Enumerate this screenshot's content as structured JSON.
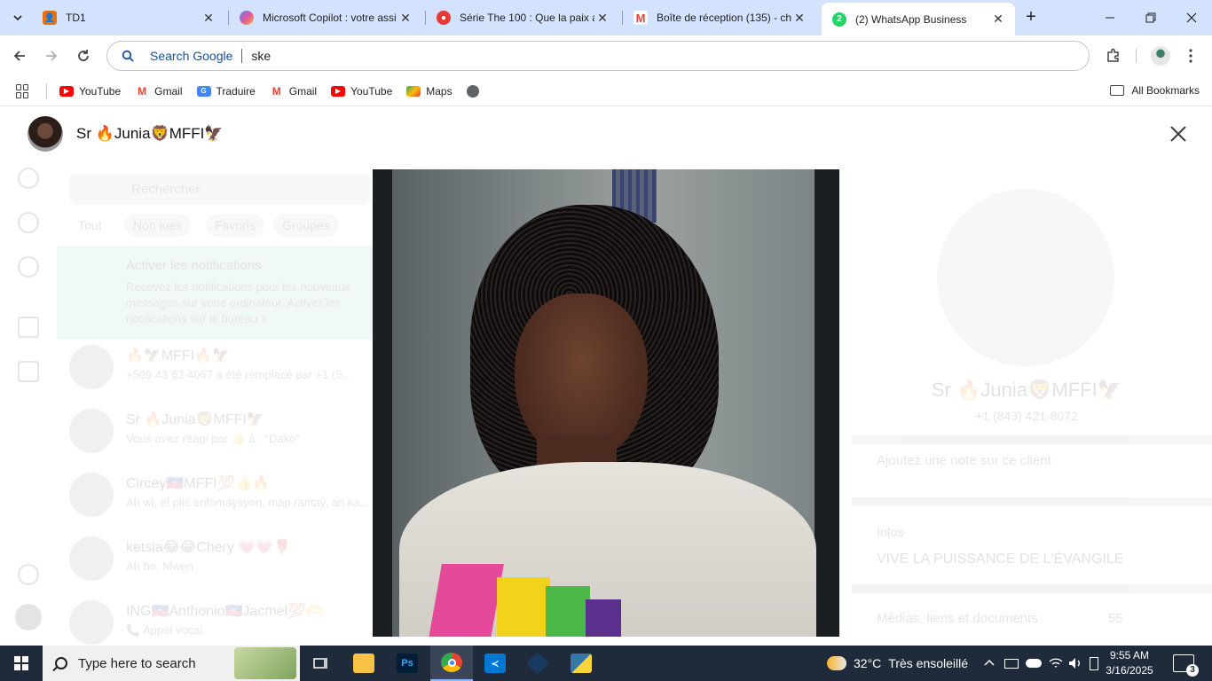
{
  "browser": {
    "tabs": [
      {
        "title": "TD1",
        "icon": "orange-classroom-icon",
        "color": "#e8710a"
      },
      {
        "title": "Microsoft Copilot : votre assi",
        "icon": "copilot-icon",
        "color": "#4e8df5"
      },
      {
        "title": "Série The 100 : Que la paix a",
        "icon": "red-speech-icon",
        "color": "#e53935"
      },
      {
        "title": "Boîte de réception (135) - ch",
        "icon": "gmail-icon",
        "color": "#ea4335"
      },
      {
        "title": "(2) WhatsApp Business",
        "icon": "whatsapp-business-icon",
        "color": "#25d366",
        "badge": "2",
        "active": true
      }
    ],
    "omnibox": {
      "prefix": "Search Google",
      "query": "ske"
    },
    "bookmarks": [
      {
        "label": "YouTube",
        "icon": "youtube-icon",
        "color": "#ff0000"
      },
      {
        "label": "Gmail",
        "icon": "gmail-icon",
        "color": "#ea4335"
      },
      {
        "label": "Traduire",
        "icon": "google-translate-icon",
        "color": "#4285f4"
      },
      {
        "label": "Gmail",
        "icon": "gmail-icon",
        "color": "#ea4335"
      },
      {
        "label": "YouTube",
        "icon": "youtube-icon",
        "color": "#ff0000"
      },
      {
        "label": "Maps",
        "icon": "google-maps-icon",
        "color": "#34a853"
      }
    ],
    "all_bookmarks": "All Bookmarks"
  },
  "viewer": {
    "contact_name": "Sr 🔥Junia🦁MFFI🦅",
    "photo_alt": "profile photo"
  },
  "background": {
    "search_placeholder": "Rechercher",
    "filters": [
      "Tout",
      "Non lues",
      "Favoris",
      "Groupes"
    ],
    "banner_title": "Activer les notifications",
    "banner_text": "Recevez les notifications pour les nouveaux messages sur votre ordinateur.",
    "banner_link": "Activer les notifications sur le bureau >",
    "chats": [
      {
        "name": "🔥🦅MFFI🔥🦅",
        "msg": "+509 43 63 4067 a été remplacé par +1 (5..."
      },
      {
        "name": "Sr 🔥Junia🦁MFFI🦅",
        "msg": "Vous avez réagi par 👍 à : \"Dako\""
      },
      {
        "name": "Circey🇭🇹MFFI💯👍🔥",
        "msg": "Ah wi, el plis enfòmaysyon, map rantay, an ka..."
      },
      {
        "name": "ketsia😂😂Chery 💗💗🌹",
        "msg": "Ah bo. Mwen"
      },
      {
        "name": "ING🇭🇹Anthonio🇭🇹Jacmel💯🫶",
        "msg": "📞 Appel vocal"
      }
    ],
    "profile": {
      "name": "Sr 🔥Junia🦁MFFI🦅",
      "phone": "+1 (843) 421-8072",
      "note_placeholder": "Ajoutez une note sur ce client",
      "info_label": "Infos",
      "info_value": "VIVE LA PUISSANCE DE L'ÉVANGILE",
      "media_label": "Médias, liens et documents",
      "media_count": "55"
    }
  },
  "taskbar": {
    "search_placeholder": "Type here to search",
    "apps": [
      {
        "name": "task-view-icon"
      },
      {
        "name": "file-explorer-icon",
        "color": "#f6c344"
      },
      {
        "name": "photoshop-icon",
        "color": "#001e36",
        "label": "Ps"
      },
      {
        "name": "chrome-icon",
        "color": "#4285f4",
        "active": true
      },
      {
        "name": "vscode-icon",
        "color": "#0078d4"
      },
      {
        "name": "virtualbox-icon",
        "color": "#183a61"
      },
      {
        "name": "python-idle-icon",
        "color": "#ffd43b"
      }
    ],
    "weather": {
      "temp": "32°C",
      "desc": "Très ensoleillé"
    },
    "time": "9:55 AM",
    "date": "3/16/2025",
    "notifications": "3"
  }
}
